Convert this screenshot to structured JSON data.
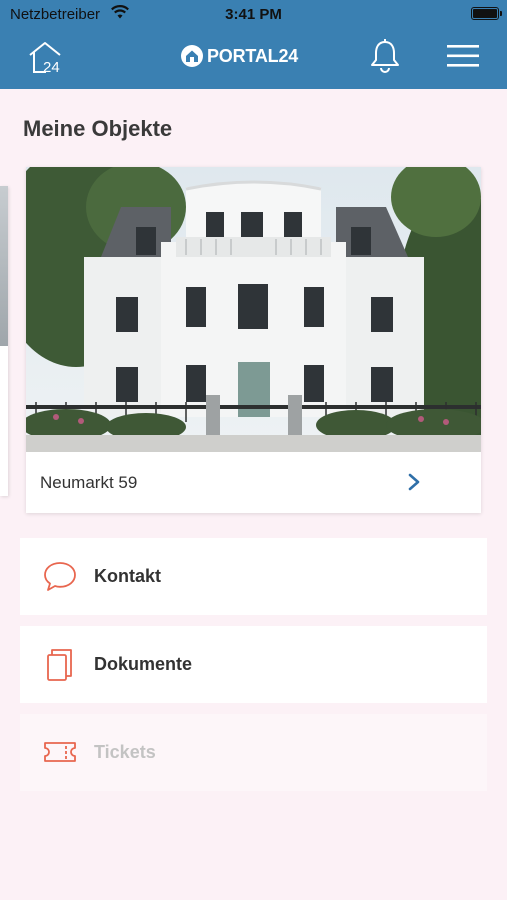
{
  "status_bar": {
    "carrier": "Netzbetreiber",
    "time": "3:41 PM"
  },
  "nav": {
    "logo_text": "PORTAL24",
    "home_icon_text": "24"
  },
  "page": {
    "title": "Meine Objekte"
  },
  "property": {
    "name": "Neumarkt 59"
  },
  "menu": {
    "items": [
      {
        "label": "Kontakt",
        "icon": "chat-bubble-icon",
        "enabled": true
      },
      {
        "label": "Dokumente",
        "icon": "documents-icon",
        "enabled": true
      },
      {
        "label": "Tickets",
        "icon": "ticket-icon",
        "enabled": false
      }
    ]
  },
  "colors": {
    "brand_blue": "#3a80b2",
    "accent_coral": "#e8664f",
    "background": "#fcf1f6"
  }
}
